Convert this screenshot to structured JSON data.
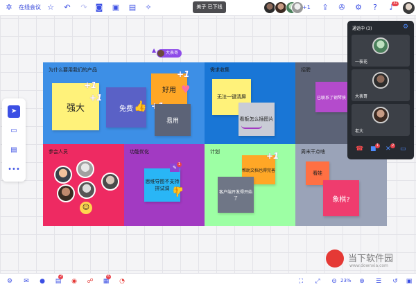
{
  "topbar": {
    "app_title": "在线会议",
    "notice": "美子 已下线",
    "more_members": "+1",
    "notify_count": "32"
  },
  "colors": {
    "accent": "#3b4fe4",
    "region_why": "#3d8fe6",
    "region_needs": "#1976d6",
    "region_recruit": "#5c6377",
    "region_members": "#ee2a62",
    "region_features": "#a23ac2",
    "region_plan": "#9dffa4",
    "region_weekend": "#9aa3b8"
  },
  "board": {
    "cursor_label": "大表哥",
    "regions": {
      "why": "为什么要用我们的产品",
      "needs": "需求收集",
      "recruit": "招聘",
      "members": "参会人员",
      "features": "功能优化",
      "plan": "计划",
      "weekend": "周末干点啥"
    },
    "notes": {
      "strong": "强大",
      "free": "免费",
      "good": "好用",
      "easy": "易用",
      "unlimited": "无法一键清屏",
      "insert_image": "看板怎么插图片",
      "contacted": "已联系了钢琴侠",
      "mindmap": "思维导图不支持拼试调",
      "help_text": "帮助文档也得完善",
      "client_dev": "客户端开发得开始了",
      "watch_show": "看娃",
      "chess": "象棋?"
    },
    "plus_one": "+1",
    "feature_badge": "1"
  },
  "toolpanel": {
    "select": "select",
    "sticky": "sticky-note",
    "comment": "comment",
    "more": "more"
  },
  "call": {
    "title": "通话中 (3)",
    "participants": [
      "一枝花",
      "大表哥",
      "老大"
    ],
    "badges": [
      "1",
      "2"
    ]
  },
  "bottombar": {
    "badge_a": "2",
    "badge_b": "6",
    "zoom": "23%"
  },
  "watermark": {
    "cn": "当下软件园",
    "en": "www.downxia.com"
  }
}
